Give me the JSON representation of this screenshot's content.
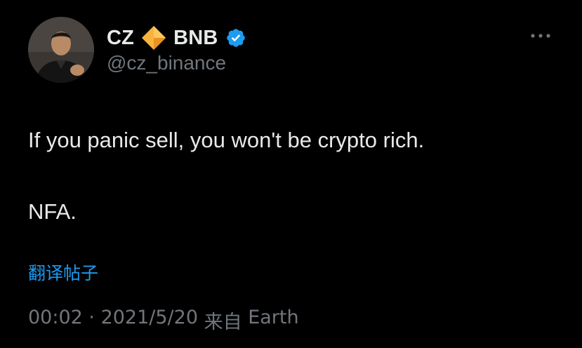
{
  "author": {
    "display_name_first": "CZ",
    "display_name_second": "BNB",
    "handle": "@cz_binance",
    "avatar_icon": "avatar-photo",
    "badge_icon": "orange-diamond-icon",
    "verified_icon": "verified-badge-icon"
  },
  "tweet": {
    "lines": [
      "If you panic sell, you won't be crypto rich.",
      "NFA."
    ],
    "translate_label": "翻译帖子"
  },
  "meta": {
    "time": "00:02",
    "separator": " · ",
    "date": "2021/5/20",
    "source_prefix": " 来自 ",
    "source": "Earth"
  },
  "colors": {
    "background": "#000000",
    "text_primary": "#e7e9ea",
    "text_secondary": "#71767b",
    "link": "#1d9bf0",
    "verified": "#1d9bf0",
    "diamond": "#f3a72b"
  }
}
